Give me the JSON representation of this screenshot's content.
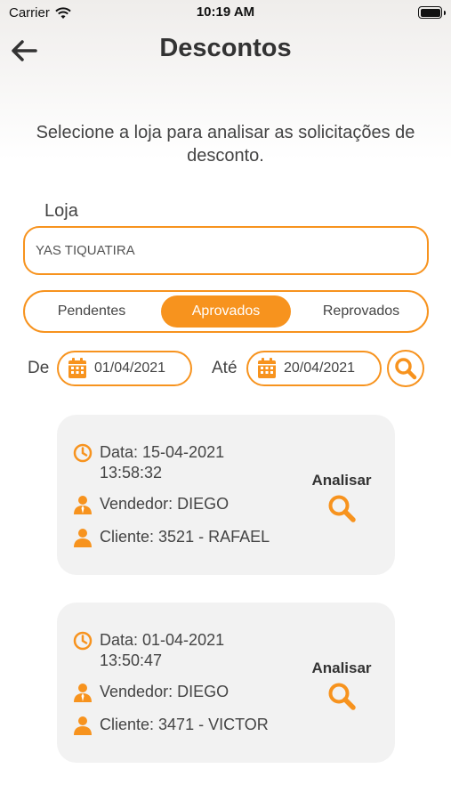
{
  "status_bar": {
    "carrier": "Carrier",
    "time": "10:19 AM"
  },
  "header": {
    "title": "Descontos"
  },
  "intro": "Selecione a loja para analisar as solicitações de desconto.",
  "loja": {
    "label": "Loja",
    "value": "YAS TIQUATIRA"
  },
  "tabs": [
    {
      "label": "Pendentes",
      "active": false
    },
    {
      "label": "Aprovados",
      "active": true
    },
    {
      "label": "Reprovados",
      "active": false
    }
  ],
  "dates": {
    "from_label": "De",
    "from": "01/04/2021",
    "to_label": "Até",
    "to": "20/04/2021"
  },
  "cards": [
    {
      "data_line1": "Data: 15-04-2021",
      "data_line2": "13:58:32",
      "vendedor": "Vendedor: DIEGO",
      "cliente": "Cliente: 3521 - RAFAEL",
      "action": "Analisar"
    },
    {
      "data_line1": "Data: 01-04-2021",
      "data_line2": "13:50:47",
      "vendedor": "Vendedor: DIEGO",
      "cliente": "Cliente: 3471 - VICTOR",
      "action": "Analisar"
    }
  ],
  "colors": {
    "accent": "#f7931e",
    "card_bg": "#f2f2f2",
    "text": "#333333"
  },
  "icons": [
    "wifi-icon",
    "battery-icon",
    "back-arrow-icon",
    "calendar-icon",
    "search-icon",
    "clock-icon",
    "salesperson-icon",
    "person-icon"
  ]
}
